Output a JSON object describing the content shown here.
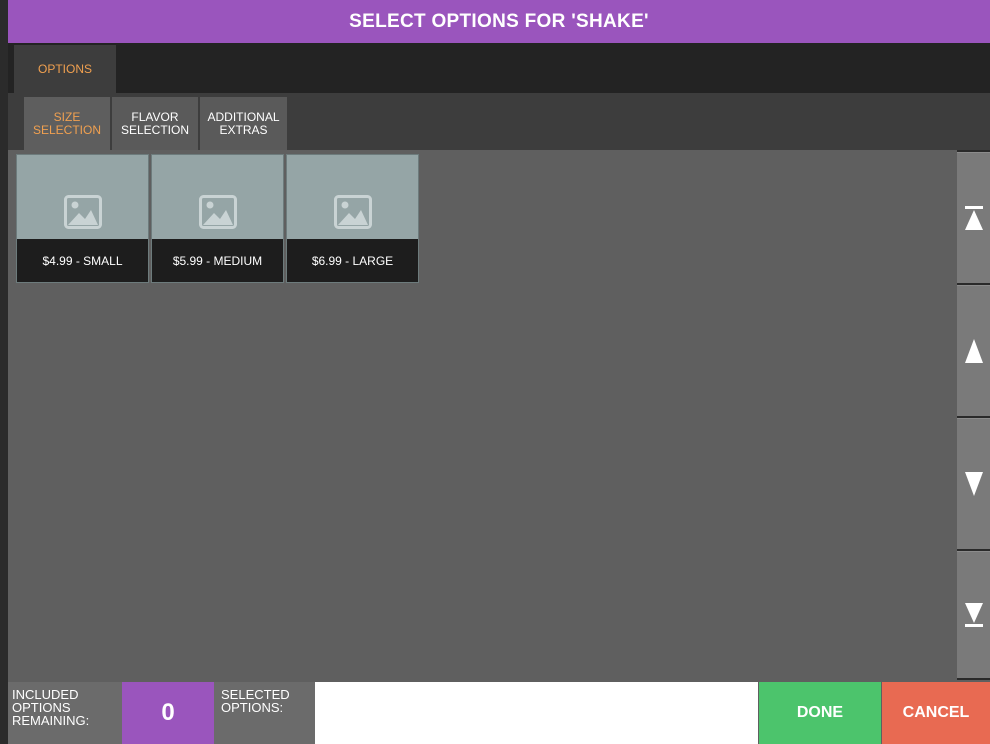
{
  "window": {
    "title": "SELECT OPTIONS FOR 'SHAKE'"
  },
  "tabs": [
    {
      "label": "OPTIONS",
      "active": true
    }
  ],
  "subtabs": [
    {
      "label": "SIZE\nSELECTION",
      "active": true
    },
    {
      "label": "FLAVOR\nSELECTION",
      "active": false
    },
    {
      "label": "ADDITIONAL\nEXTRAS",
      "active": false
    }
  ],
  "items": [
    {
      "label": "$4.99 - SMALL",
      "icon": "image-placeholder-icon"
    },
    {
      "label": "$5.99 - MEDIUM",
      "icon": "image-placeholder-icon"
    },
    {
      "label": "$6.99 - LARGE",
      "icon": "image-placeholder-icon"
    }
  ],
  "scroll": {
    "icons": [
      "scroll-to-top-icon",
      "scroll-up-icon",
      "scroll-down-icon",
      "scroll-to-bottom-icon"
    ]
  },
  "footer": {
    "included_label": "INCLUDED\nOPTIONS\nREMAINING:",
    "included_count": "0",
    "selected_label": "SELECTED\nOPTIONS:",
    "selected_value": "",
    "done_label": "DONE",
    "cancel_label": "CANCEL"
  },
  "colors": {
    "accent_purple": "#9a55bd",
    "active_orange": "#f0a050",
    "done_green": "#4cc46c",
    "cancel_red": "#e86a52"
  }
}
